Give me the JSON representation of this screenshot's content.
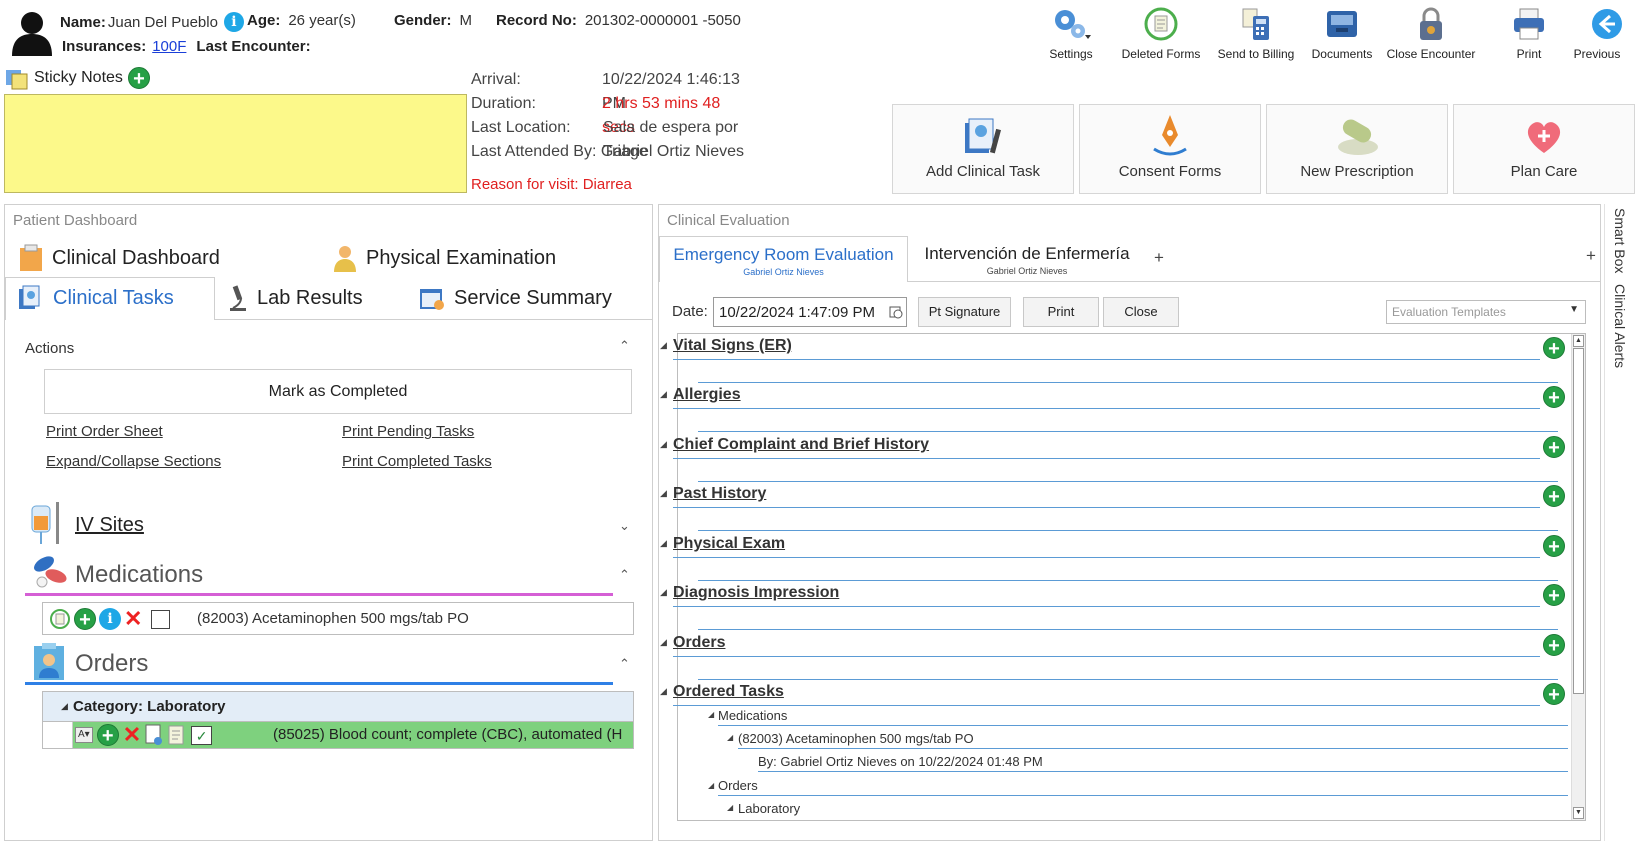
{
  "header": {
    "name_label": "Name:",
    "name_value": "Juan Del Pueblo",
    "age_label": "Age:",
    "age_value": "26 year(s)",
    "gender_label": "Gender:",
    "gender_value": "M",
    "record_label": "Record No:",
    "record_value": "201302-0000001 -5050",
    "insurances_label": "Insurances:",
    "insurances_value": "100F",
    "last_encounter_label": "Last Encounter:"
  },
  "toolbar": {
    "settings": "Settings",
    "deleted_forms": "Deleted Forms",
    "send_to_billing": "Send to Billing",
    "documents": "Documents",
    "close_encounter": "Close Encounter",
    "print": "Print",
    "previous": "Previous"
  },
  "sticky": {
    "label": "Sticky Notes",
    "note_color": "#fcf98a"
  },
  "visit": {
    "arrival_label": "Arrival:",
    "arrival_value": "10/22/2024 1:46:13 PM",
    "duration_label": "Duration:",
    "duration_value": "2 hrs 53 mins 48 secs",
    "location_label": "Last Location:",
    "location_value": "Sala de espera por Triage",
    "attended_label": "Last Attended By:",
    "attended_value": "Gabriel Ortiz Nieves",
    "reason": "Reason for visit: Diarrea"
  },
  "tiles": {
    "add_clinical_task": "Add Clinical Task",
    "consent_forms": "Consent Forms",
    "new_prescription": "New Prescription",
    "plan_care": "Plan Care"
  },
  "left": {
    "title": "Patient Dashboard",
    "tabs": {
      "clinical_dashboard": "Clinical Dashboard",
      "physical_examination": "Physical Examination",
      "clinical_tasks": "Clinical Tasks",
      "lab_results": "Lab Results",
      "service_summary": "Service Summary"
    },
    "actions_label": "Actions",
    "mark_completed": "Mark as Completed",
    "print_order_sheet": "Print Order Sheet",
    "print_pending": "Print Pending Tasks",
    "expand_collapse": "Expand/Collapse Sections",
    "print_completed": "Print Completed Tasks",
    "iv_sites": "IV Sites",
    "medications": "Medications",
    "med_item": "(82003) Acetaminophen 500 mgs/tab PO",
    "orders": "Orders",
    "category": "Category: Laboratory",
    "order_item": "(85025) Blood count; complete (CBC), automated (H",
    "colors": {
      "medications_line": "#d55fd5",
      "orders_line": "#2f80e6",
      "order_row": "#7ed17e"
    }
  },
  "right": {
    "title": "Clinical Evaluation",
    "tab1": "Emergency Room Evaluation",
    "tab1_sub": "Gabriel Ortiz Nieves",
    "tab2": "Intervención de Enfermería",
    "tab2_sub": "Gabriel Ortiz Nieves",
    "tab_add": "+",
    "tab_add_right": "+",
    "date_label": "Date:",
    "date_value": "10/22/2024 1:47:09 PM",
    "pt_signature": "Pt Signature",
    "print": "Print",
    "close": "Close",
    "templates_placeholder": "Evaluation Templates",
    "sections": [
      "Vital Signs (ER)",
      "Allergies",
      "Chief Complaint and Brief History",
      "Past History",
      "Physical Exam",
      "Diagnosis Impression",
      "Orders",
      "Ordered Tasks"
    ],
    "tree": {
      "medications": "Medications",
      "med_item": "(82003) Acetaminophen 500 mgs/tab PO",
      "med_by": "By: Gabriel Ortiz Nieves on 10/22/2024 01:48 PM",
      "orders": "Orders",
      "laboratory": "Laboratory"
    }
  },
  "side": {
    "smart_box": "Smart Box",
    "clinical_alerts": "Clinical Alerts"
  }
}
